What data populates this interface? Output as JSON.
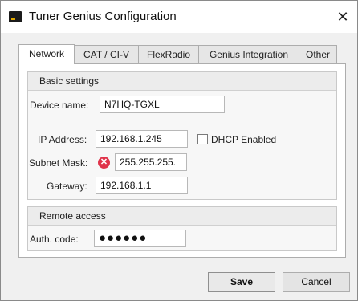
{
  "window": {
    "title": "Tuner Genius Configuration",
    "close_glyph": "✕"
  },
  "tabs": [
    {
      "label": "Network",
      "active": true
    },
    {
      "label": "CAT / CI-V",
      "active": false
    },
    {
      "label": "FlexRadio",
      "active": false
    },
    {
      "label": "Genius Integration",
      "active": false
    },
    {
      "label": "Other",
      "active": false
    }
  ],
  "basic_settings": {
    "header": "Basic settings",
    "device_name": {
      "label": "Device name:",
      "value": "N7HQ-TGXL"
    },
    "ip_address": {
      "label": "IP Address:",
      "value": "192.168.1.245"
    },
    "dhcp": {
      "label": "DHCP Enabled",
      "checked": false
    },
    "subnet_mask": {
      "label": "Subnet Mask:",
      "value": "255.255.255.",
      "error_icon": "error-x-icon",
      "error_glyph": "✕"
    },
    "gateway": {
      "label": "Gateway:",
      "value": "192.168.1.1"
    }
  },
  "remote_access": {
    "header": "Remote access",
    "auth_code": {
      "label": "Auth. code:",
      "value": "●●●●●●"
    }
  },
  "buttons": {
    "save": "Save",
    "cancel": "Cancel"
  },
  "colors": {
    "error": "#e0334a",
    "window_bg": "#f0f0f0",
    "titlebar": "#ffffff"
  }
}
